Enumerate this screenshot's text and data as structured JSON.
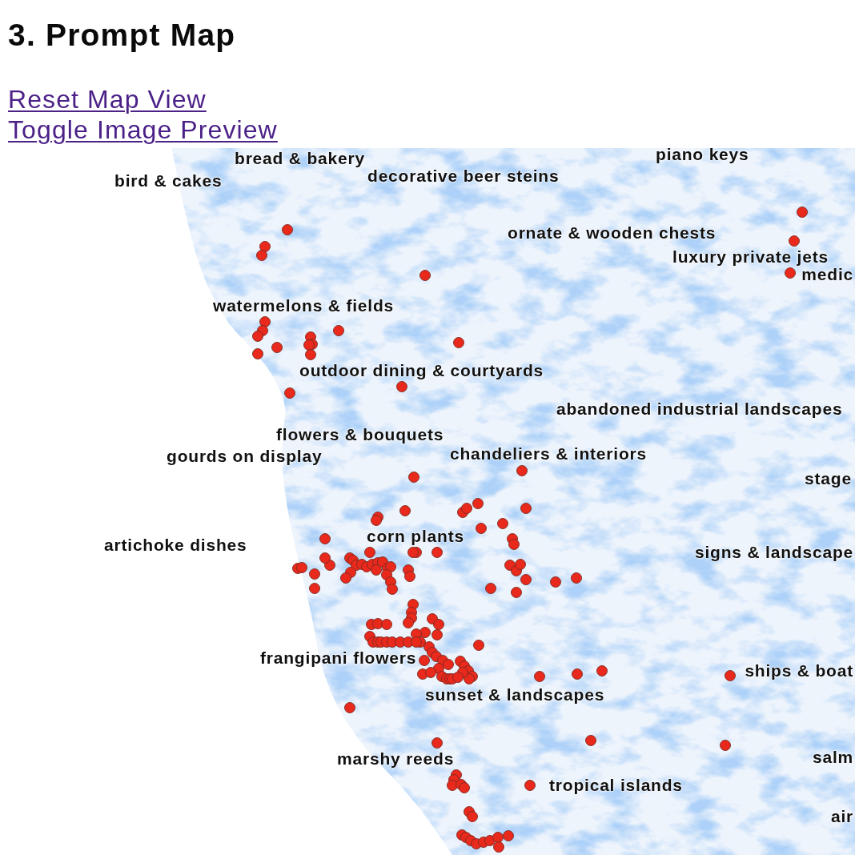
{
  "section": {
    "title": "3. Prompt Map"
  },
  "links": [
    "Reset Map View",
    "Toggle Image Preview"
  ],
  "map": {
    "labels": [
      "piano keys",
      "bread & bakery",
      "decorative beer steins",
      "bird & cakes",
      "ornate & wooden chests",
      "luxury private jets",
      "medic",
      "watermelons & fields",
      "outdoor dining & courtyards",
      "abandoned industrial landscapes",
      "flowers & bouquets",
      "gourds on display",
      "chandeliers & interiors",
      "stage",
      "corn plants",
      "artichoke dishes",
      "signs & landscape",
      "frangipani flowers",
      "ships & boat",
      "sunset & landscapes",
      "marshy reeds",
      "salm",
      "tropical islands",
      "air"
    ]
  }
}
